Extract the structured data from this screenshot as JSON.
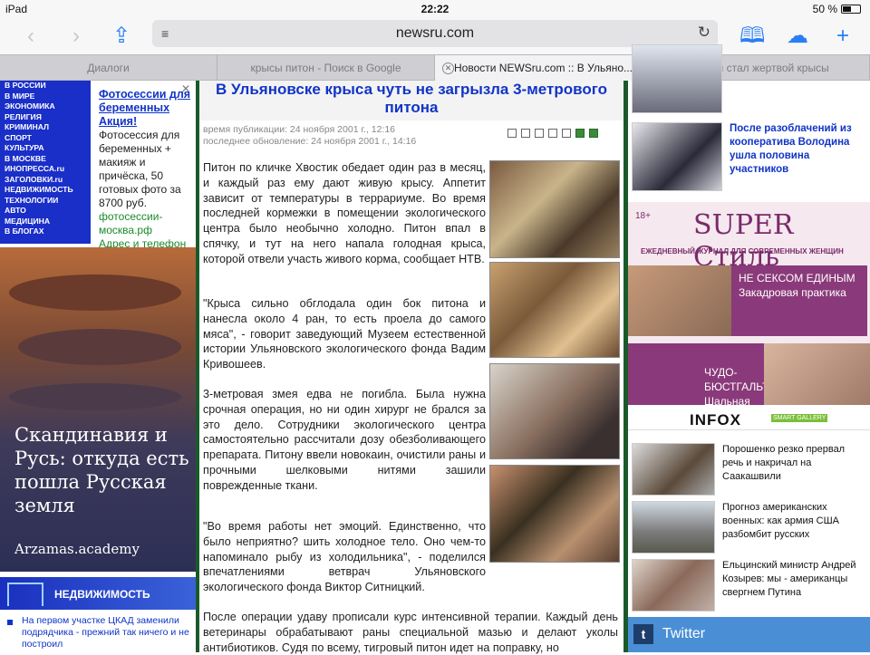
{
  "status_bar": {
    "device": "iPad",
    "time": "22:22",
    "battery": "50 %"
  },
  "toolbar": {
    "url": "newsru.com"
  },
  "tabs": [
    {
      "label": "Диалоги"
    },
    {
      "label": "крысы питон - Поиск в Google"
    },
    {
      "label": "Новости NEWSru.com :: В Ульяно..."
    },
    {
      "label": "Питон стал жертвой крысы"
    }
  ],
  "left": {
    "nav": [
      "В РОССИИ",
      "В МИРЕ",
      "ЭКОНОМИКА",
      "РЕЛИГИЯ",
      "КРИМИНАЛ",
      "СПОРТ",
      "КУЛЬТУРА",
      "В МОСКВЕ",
      "ИНОПРЕССА.ru",
      "ЗАГОЛОВКИ.ru",
      "НЕДВИЖИМОСТЬ",
      "ТЕХНОЛОГИИ",
      "АВТО",
      "МЕДИЦИНА",
      "В БЛОГАХ"
    ],
    "ad": {
      "title": "Фотосессии для беременных Акция!",
      "body": "Фотосессия для беременных + макияж и причёска, 50 готовых фото за 8700 руб.",
      "link": "фотосессии-москва.рф",
      "extra": "Адрес и телефон"
    },
    "arzamas": {
      "title": "Скандинавия и Русь: откуда есть пошла Русская земля",
      "site": "Arzamas.academy"
    },
    "realty_label": "НЕДВИЖИМОСТЬ",
    "realty_news": "На первом участке ЦКАД заменили подрядчика - прежний так ничего и не построил"
  },
  "article": {
    "headline": "В Ульяновске крыса чуть не загрызла 3-метрового питона",
    "published": "время публикации: 24 ноября 2001 г., 12:16",
    "updated": "последнее обновление: 24 ноября 2001 г., 14:16",
    "paragraphs": [
      "Питон по кличке Хвостик обедает один раз в месяц, и каждый раз ему дают живую крысу. Аппетит зависит от температуры в террариуме. Во время последней кормежки в помещении экологического центра было необычно холодно. Питон впал в спячку, и тут на него напала голодная крыса, которой отвели участь живого корма, сообщает НТВ.",
      "\"Крыса сильно обглодала один бок питона и нанесла около 4 ран, то есть проела до самого мяса\", - говорит заведующий Музеем естественной истории Ульяновского экологического фонда Вадим Кривошеев.",
      "3-метровая змея едва не погибла. Была нужна срочная операция, но ни один хирург не брался за это дело. Сотрудники экологического центра самостоятельно рассчитали дозу обезболивающего препарата. Питону ввели новокаин, очистили раны и прочными шелковыми нитями зашили поврежденные ткани.",
      "\"Во время работы нет эмоций. Единственно, что было неприятно? шить холодное тело. Оно чем-то напоминало рыбу из холодильника\", - поделился впечатлениями ветврач Ульяновского экологического фонда Виктор Ситницкий.",
      "После операции удаву прописали курс интенсивной терапии. Каждый день ветеринары обрабатывают раны специальной мазью и делают уколы антибиотиков. Судя по всему, тигровый питон идет на поправку, но"
    ]
  },
  "right": {
    "news1": "После разоблачений из кооператива Володина ушла половина участников",
    "super": {
      "age": "18+",
      "logo": "SUPER Стиль",
      "sub": "ЕЖЕДНЕВНЫЙ ЖУРНАЛ ДЛЯ СОВРЕМЕННЫХ ЖЕНЩИН",
      "box1": "НЕ СЕКСОМ ЕДИНЫМ Закадровая практика",
      "box2": "ЧУДО-БЮСТГАЛЬТЕР Шальная пуля"
    },
    "infox": {
      "logo": "INFOX",
      "badge": "SMART GALLERY"
    },
    "infox_news": [
      "Порошенко резко прервал речь и накричал на Саакашвили",
      "Прогноз американских военных: как армия США разбомбит русских",
      "Ельцинский министр Андрей Козырев: мы - американцы свергнем Путина"
    ],
    "twitter": "Twitter"
  }
}
